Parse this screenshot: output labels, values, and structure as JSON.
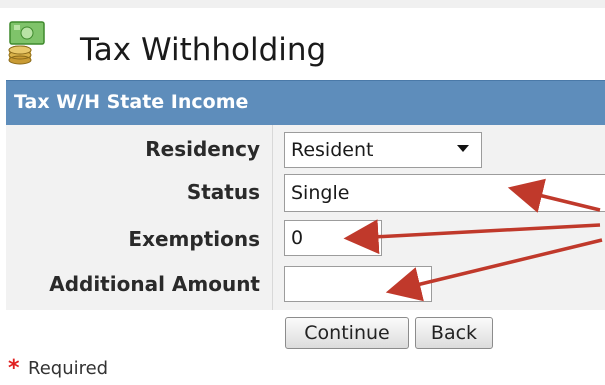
{
  "page": {
    "title": "Tax Withholding"
  },
  "section": {
    "title": "Tax W/H State Income"
  },
  "form": {
    "residency": {
      "label": "Residency",
      "value": "Resident"
    },
    "status": {
      "label": "Status",
      "value": "Single"
    },
    "exemptions": {
      "label": "Exemptions",
      "value": "0"
    },
    "additional_amount": {
      "label": "Additional Amount",
      "value": ""
    }
  },
  "buttons": {
    "continue": "Continue",
    "back": "Back"
  },
  "footer": {
    "required_star": "*",
    "required_label": "Required"
  },
  "icons": {
    "app_icon": "money-coins-icon",
    "callout": "red-callout-arrows"
  },
  "colors": {
    "section_bar": "#5e8dbb",
    "form_bg": "#f2f2f2",
    "annotation": "#c0392b",
    "required_star": "#e02020"
  }
}
